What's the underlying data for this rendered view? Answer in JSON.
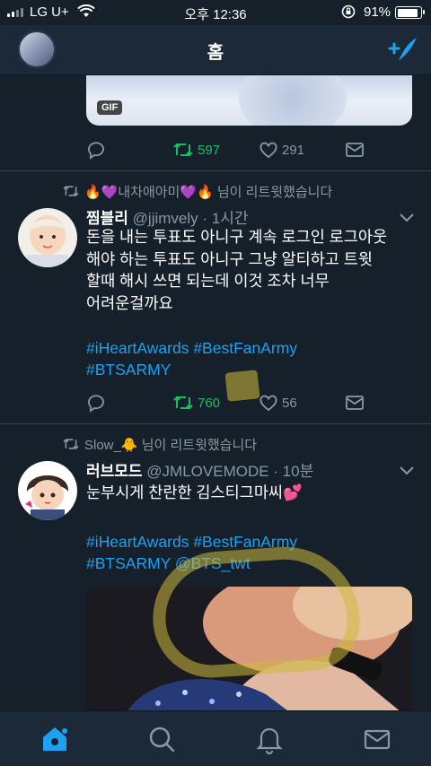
{
  "status_bar": {
    "carrier": "LG U+",
    "time": "오후 12:36",
    "battery": "91%",
    "battery_level": 0.91
  },
  "nav": {
    "title": "홈",
    "avatar_icon": "profile-avatar",
    "compose_icon": "compose-tweet-icon"
  },
  "tweet0": {
    "gif_label": "GIF",
    "retweets": "597",
    "likes": "291"
  },
  "tweet1": {
    "retweeted_by": "🔥💜내차애아미💜🔥 님이 리트윗했습니다",
    "name": "찜블리",
    "handle": "@jjimvely · 1시간",
    "text": "돈을 내는 투표도 아니구 계속 로그인 로그아웃\n해야 하는 투표도 아니구 그냥 알티하고 트윗\n할때 해시 쓰면 되는데 이것 조차 너무\n어려운걸까요",
    "hashtags_line1": "#iHeartAwards #BestFanArmy",
    "hashtags_line2": "#BTSARMY",
    "retweets": "760",
    "likes": "56"
  },
  "tweet2": {
    "retweeted_by": "Slow_🐥 님이 리트윗했습니다",
    "name": "러브모드",
    "handle": "@JMLOVEMODE · 10분",
    "text": "눈부시게 찬란한 김스티그마씨💕",
    "hashtags_line1": "#iHeartAwards #BestFanArmy",
    "hashtags_line2": "#BTSARMY @BTS_twt"
  },
  "tabbar": {
    "items": [
      "home-icon",
      "search-icon",
      "notifications-icon",
      "messages-icon"
    ],
    "active": "home-icon"
  },
  "colors": {
    "background": "#15202b",
    "bar": "#1c2938",
    "accent": "#1da1f2",
    "retweet_active": "#17bf63",
    "muted": "#8899a6"
  }
}
